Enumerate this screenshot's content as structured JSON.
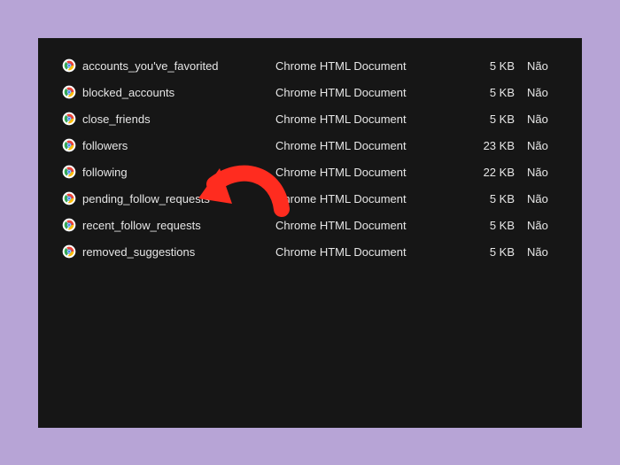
{
  "colors": {
    "background": "#b7a4d6",
    "panel": "#161616",
    "text": "#e6e6e6",
    "arrow": "#ff2c1f"
  },
  "icon": "chrome-icon",
  "files": [
    {
      "name": "accounts_you've_favorited",
      "type": "Chrome HTML Document",
      "size": "5 KB",
      "extra": "Não"
    },
    {
      "name": "blocked_accounts",
      "type": "Chrome HTML Document",
      "size": "5 KB",
      "extra": "Não"
    },
    {
      "name": "close_friends",
      "type": "Chrome HTML Document",
      "size": "5 KB",
      "extra": "Não"
    },
    {
      "name": "followers",
      "type": "Chrome HTML Document",
      "size": "23 KB",
      "extra": "Não"
    },
    {
      "name": "following",
      "type": "Chrome HTML Document",
      "size": "22 KB",
      "extra": "Não"
    },
    {
      "name": "pending_follow_requests",
      "type": "Chrome HTML Document",
      "size": "5 KB",
      "extra": "Não"
    },
    {
      "name": "recent_follow_requests",
      "type": "Chrome HTML Document",
      "size": "5 KB",
      "extra": "Não"
    },
    {
      "name": "removed_suggestions",
      "type": "Chrome HTML Document",
      "size": "5 KB",
      "extra": "Não"
    }
  ],
  "annotation": {
    "target_index": 5,
    "kind": "curved-arrow"
  }
}
